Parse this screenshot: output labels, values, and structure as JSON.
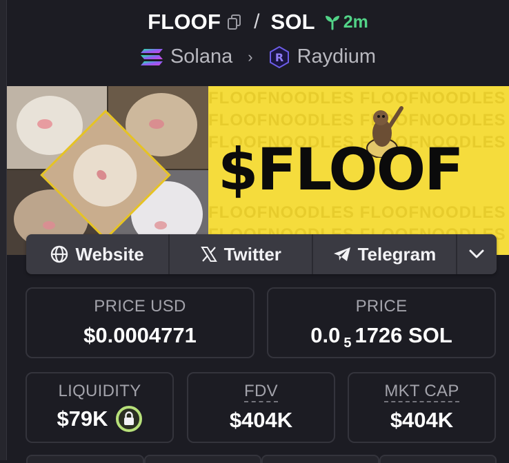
{
  "header": {
    "symbol": "FLOOF",
    "separator": "/",
    "quote": "SOL",
    "age": "2m",
    "chain": "Solana",
    "chevron": "›",
    "dex": "Raydium"
  },
  "banner": {
    "ticker": "$FLOOF",
    "watermark_text": "FLOOFNOODLES FLOOFNOODLES FLOOFNOODLES FLOOFNOODLES"
  },
  "links": {
    "website": "Website",
    "twitter": "Twitter",
    "telegram": "Telegram"
  },
  "stats": {
    "price_usd_label": "PRICE USD",
    "price_usd_value": "$0.0004771",
    "price_label": "PRICE",
    "price_native_prefix": "0.0",
    "price_native_zeros": "5",
    "price_native_rest": "1726 SOL",
    "liquidity_label": "LIQUIDITY",
    "liquidity_value": "$79K",
    "fdv_label": "FDV",
    "fdv_value": "$404K",
    "mktcap_label": "MKT CAP",
    "mktcap_value": "$404K"
  },
  "colors": {
    "background": "#1c1c23",
    "age_green": "#52d387",
    "banner_yellow": "#f5dc3c",
    "lock_ring": "#b7e07a"
  }
}
